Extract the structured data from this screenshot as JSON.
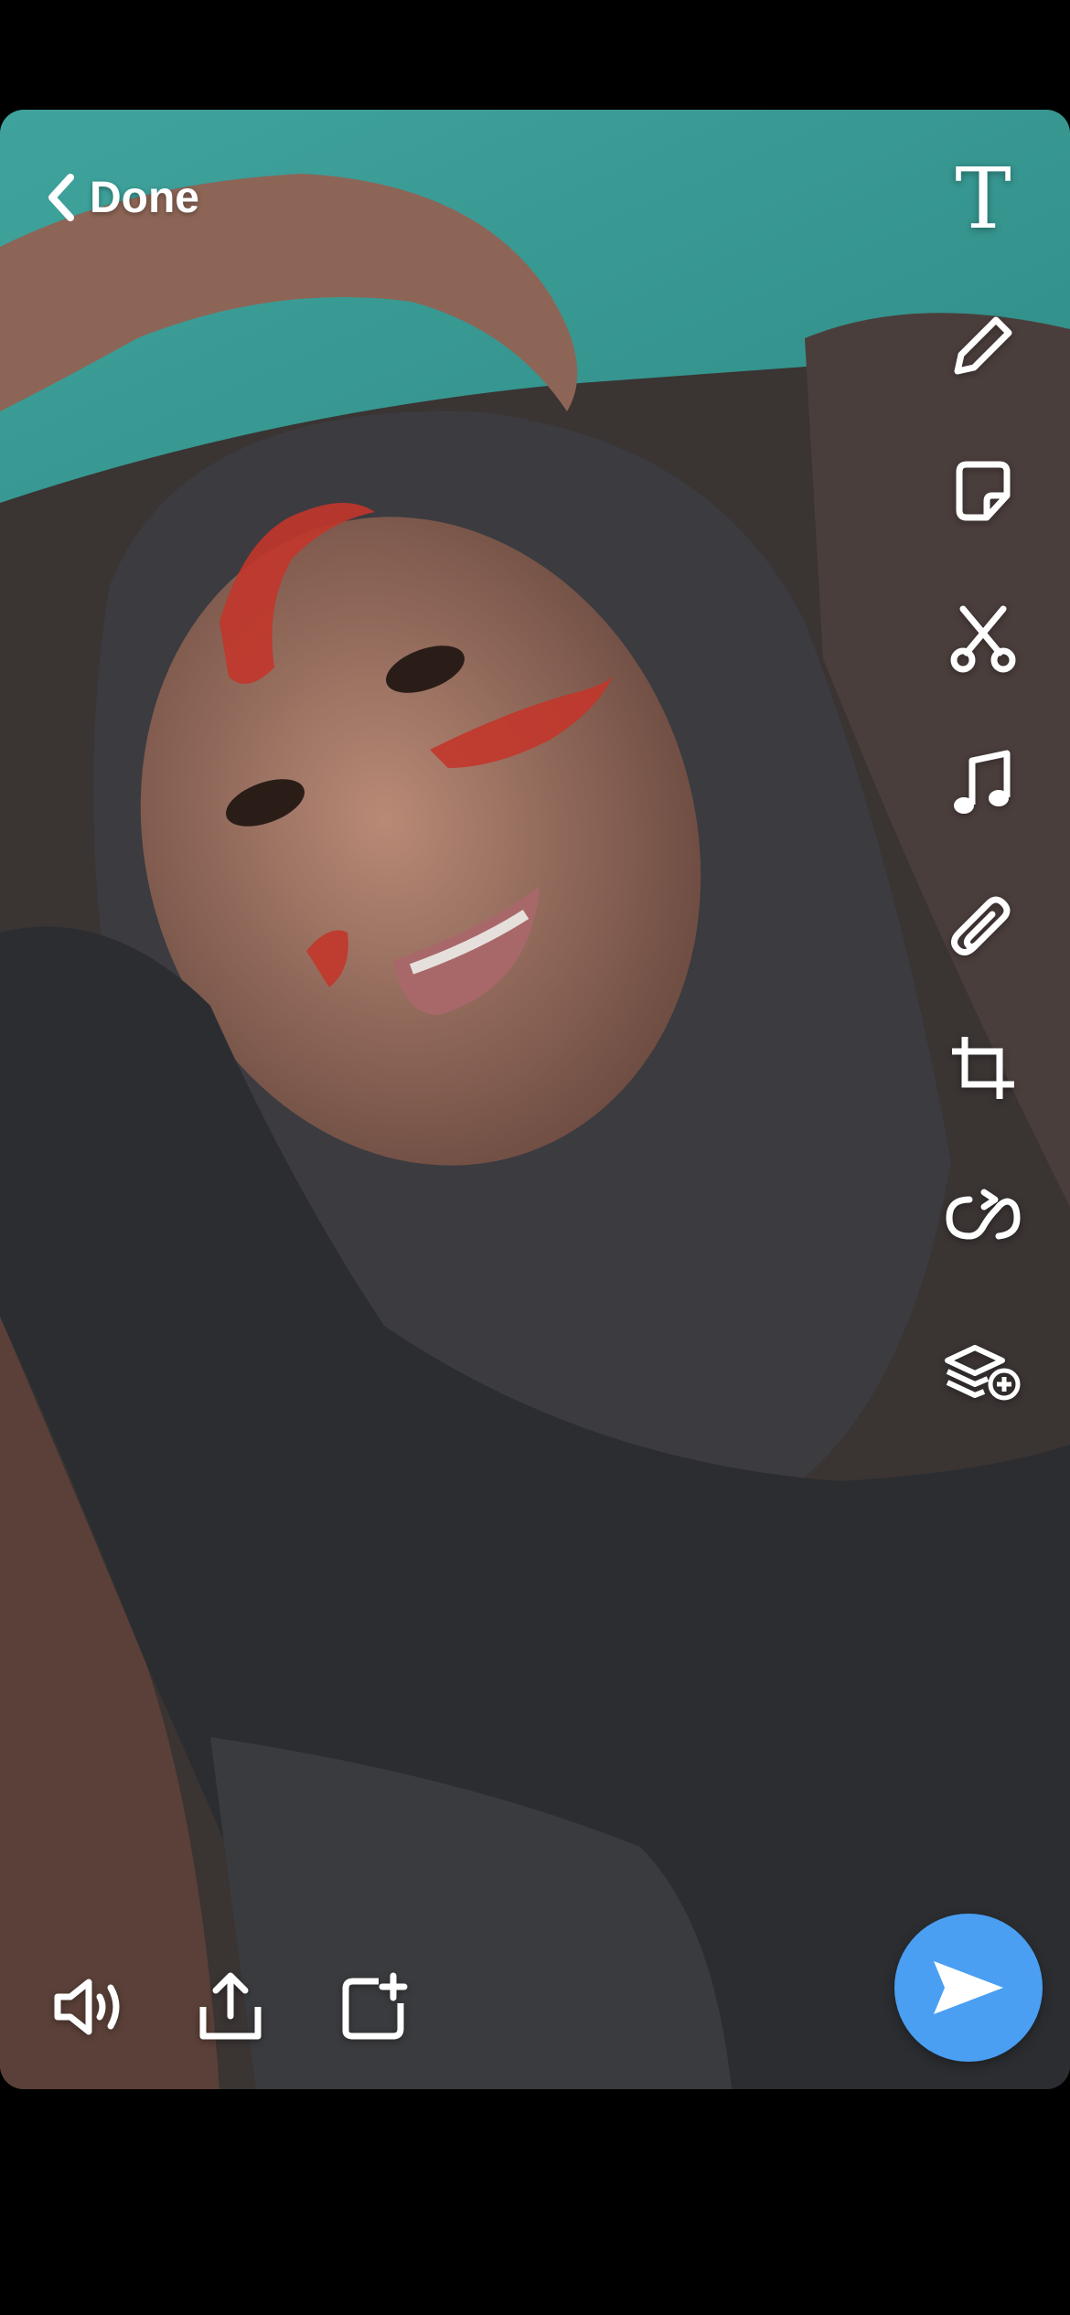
{
  "header": {
    "done_label": "Done"
  },
  "toolbar": {
    "items": [
      {
        "name": "text-tool",
        "icon": "text-icon",
        "glyph": "T"
      },
      {
        "name": "draw-tool",
        "icon": "pencil-icon"
      },
      {
        "name": "sticker-tool",
        "icon": "sticker-icon"
      },
      {
        "name": "scissors-tool",
        "icon": "scissors-icon"
      },
      {
        "name": "music-tool",
        "icon": "music-note-icon"
      },
      {
        "name": "link-tool",
        "icon": "paperclip-icon"
      },
      {
        "name": "crop-tool",
        "icon": "crop-icon"
      },
      {
        "name": "loop-tool",
        "icon": "loop-icon"
      },
      {
        "name": "layers-tool",
        "icon": "layers-add-icon"
      }
    ]
  },
  "bottom_bar": {
    "items": [
      {
        "name": "sound-button",
        "icon": "speaker-icon"
      },
      {
        "name": "share-button",
        "icon": "share-icon"
      },
      {
        "name": "save-story-button",
        "icon": "add-story-icon"
      }
    ],
    "send_icon": "send-icon"
  },
  "colors": {
    "send_button": "#4a9ff2",
    "icon": "#ffffff",
    "background": "#000000",
    "wall_teal": "#3fa39c"
  }
}
